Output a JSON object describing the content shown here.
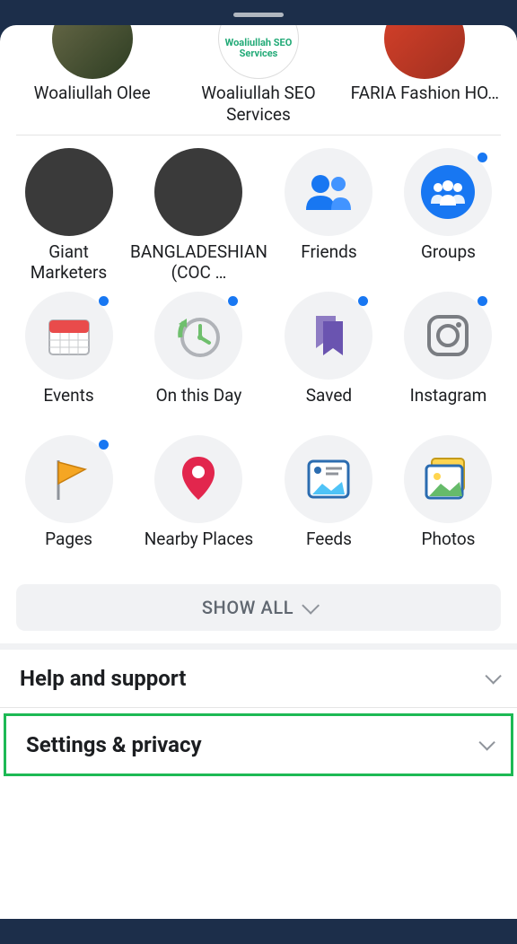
{
  "shortcuts": [
    {
      "label": "Woaliullah Olee",
      "avatar_text": ""
    },
    {
      "label": "Woaliullah SEO Services",
      "avatar_text": "Woaliullah SEO\nServices"
    },
    {
      "label": "FARIA Fashion HO…",
      "avatar_text": ""
    }
  ],
  "grid": [
    {
      "label": "Giant Marketers",
      "icon": "chalkboard-image",
      "has_dot": true
    },
    {
      "label": "BANGLADESHIAN (COC …",
      "icon": "clash-image",
      "has_dot": false
    },
    {
      "label": "Friends",
      "icon": "friends-icon",
      "has_dot": false
    },
    {
      "label": "Groups",
      "icon": "groups-icon",
      "has_dot": true
    },
    {
      "label": "Events",
      "icon": "calendar-icon",
      "has_dot": true
    },
    {
      "label": "On this Day",
      "icon": "clock-icon",
      "has_dot": true
    },
    {
      "label": "Saved",
      "icon": "bookmark-icon",
      "has_dot": true
    },
    {
      "label": "Instagram",
      "icon": "instagram-icon",
      "has_dot": true
    },
    {
      "label": "Pages",
      "icon": "flag-icon",
      "has_dot": true
    },
    {
      "label": "Nearby Places",
      "icon": "pin-icon",
      "has_dot": false
    },
    {
      "label": "Feeds",
      "icon": "feeds-icon",
      "has_dot": false
    },
    {
      "label": "Photos",
      "icon": "photos-icon",
      "has_dot": false
    }
  ],
  "show_all_label": "SHOW ALL",
  "accordion": {
    "help_label": "Help and support",
    "settings_label": "Settings & privacy"
  }
}
